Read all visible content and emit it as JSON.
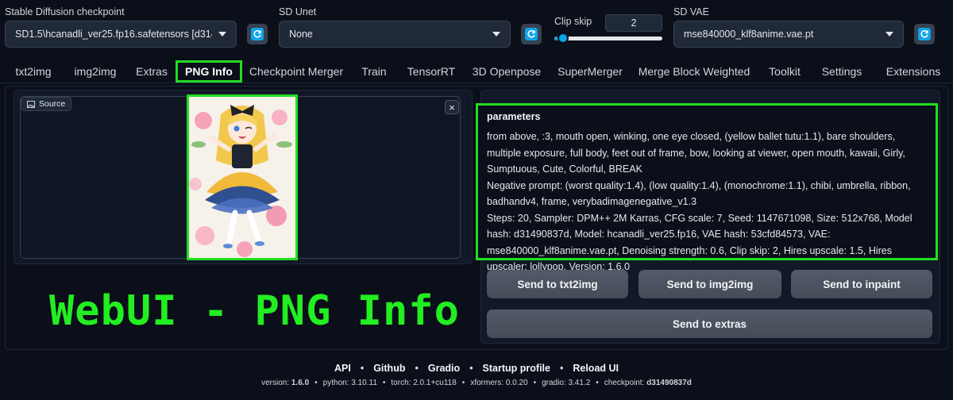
{
  "settings": {
    "checkpoint_label": "Stable Diffusion checkpoint",
    "checkpoint_value": "SD1.5\\hcanadli_ver25.fp16.safetensors [d31490837d]",
    "unet_label": "SD Unet",
    "unet_value": "None",
    "clip_skip_label": "Clip skip",
    "clip_skip_value": "2",
    "clip_skip_level": 0.08,
    "vae_label": "SD VAE",
    "vae_value": "mse840000_klf8anime.vae.pt"
  },
  "tabs": [
    {
      "label": "txt2img"
    },
    {
      "label": "img2img"
    },
    {
      "label": "Extras"
    },
    {
      "label": "PNG Info"
    },
    {
      "label": "Checkpoint Merger"
    },
    {
      "label": "Train"
    },
    {
      "label": "TensorRT"
    },
    {
      "label": "3D Openpose"
    },
    {
      "label": "SuperMerger"
    },
    {
      "label": "Merge Block Weighted"
    },
    {
      "label": "Toolkit"
    },
    {
      "label": "Settings"
    },
    {
      "label": "Extensions"
    }
  ],
  "source": {
    "label": "Source",
    "close": "×"
  },
  "overlay_title": "WebUI - PNG Info",
  "parameters": {
    "heading": "parameters",
    "prompt": "from above, :3, mouth open, winking, one eye closed, (yellow ballet tutu:1.1), bare shoulders, multiple exposure, full body, feet out of frame, bow, looking at viewer, open mouth, kawaii, Girly, Sumptuous, Cute, Colorful, BREAK",
    "negative": "Negative prompt: (worst quality:1.4), (low quality:1.4), (monochrome:1.1), chibi, umbrella, ribbon, badhandv4, frame, verybadimagenegative_v1.3",
    "settings": "Steps: 20, Sampler: DPM++ 2M Karras, CFG scale: 7, Seed: 1147671098, Size: 512x768, Model hash: d31490837d, Model: hcanadli_ver25.fp16, VAE hash: 53cfd84573, VAE: mse840000_klf8anime.vae.pt, Denoising strength: 0.6, Clip skip: 2, Hires upscale: 1.5, Hires upscaler: lollypop, Version: 1.6.0"
  },
  "buttons": {
    "txt2img": "Send to txt2img",
    "img2img": "Send to img2img",
    "inpaint": "Send to inpaint",
    "extras": "Send to extras"
  },
  "footer": {
    "links": [
      "API",
      "Github",
      "Gradio",
      "Startup profile",
      "Reload UI"
    ],
    "separator": "•",
    "version_label": "version:",
    "version": "1.6.0",
    "python_label": "python:",
    "python": "3.10.11",
    "torch_label": "torch:",
    "torch": "2.0.1+cu118",
    "xformers_label": "xformers:",
    "xformers": "0.0.20",
    "gradio_label": "gradio:",
    "gradio": "3.41.2",
    "checkpoint_label": "checkpoint:",
    "checkpoint": "d31490837d"
  },
  "colors": {
    "highlight": "#22dd22",
    "accent": "#0ea5e9",
    "background": "#0b0f19"
  }
}
